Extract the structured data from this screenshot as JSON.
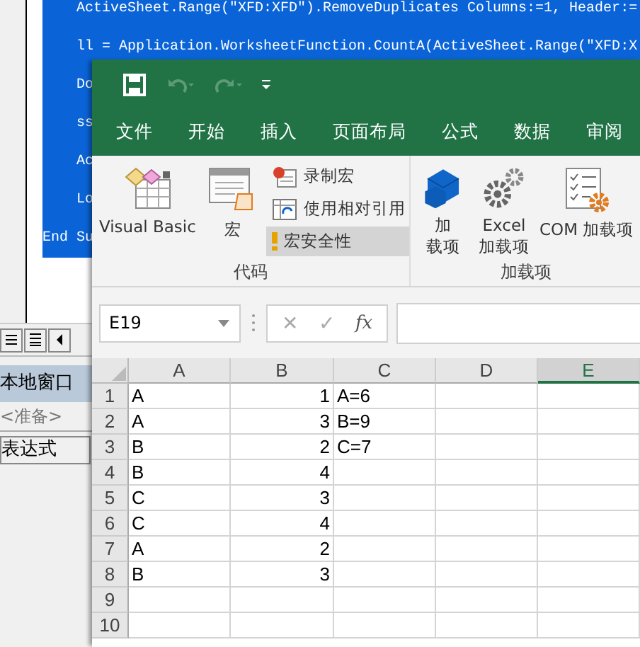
{
  "vba_editor": {
    "code_lines": [
      {
        "text": "ActiveSheet.Range(\"XFD:XFD\").RemoveDuplicates Columns:=1, Header:=",
        "indented": true,
        "selected": true
      },
      {
        "text": "ll = Application.WorksheetFunction.CountA(ActiveSheet.Range(\"XFD:X",
        "indented": true,
        "selected": true
      },
      {
        "text": "Do",
        "indented": true,
        "selected": true
      },
      {
        "text": "ss",
        "indented": true,
        "selected": true
      },
      {
        "text": "Ac",
        "indented": true,
        "selected": true
      },
      {
        "text": "Lo",
        "indented": true,
        "selected": true
      },
      {
        "text": "End Su",
        "indented": false,
        "selected": true
      }
    ],
    "locals_window": {
      "title": "本地窗口",
      "status": "<准备>",
      "column_header": "表达式"
    }
  },
  "excel": {
    "quick_access": [
      {
        "kind": "save",
        "disabled": false
      },
      {
        "kind": "undo",
        "disabled": true
      },
      {
        "kind": "redo",
        "disabled": true
      },
      {
        "kind": "customize",
        "disabled": false
      }
    ],
    "tabs": [
      {
        "label": "文件",
        "selected": false
      },
      {
        "label": "开始",
        "selected": false
      },
      {
        "label": "插入",
        "selected": false
      },
      {
        "label": "页面布局",
        "selected": false
      },
      {
        "label": "公式",
        "selected": false
      },
      {
        "label": "数据",
        "selected": false
      },
      {
        "label": "审阅",
        "selected": false
      }
    ],
    "ribbon_groups": [
      {
        "label": "代码",
        "items": [
          {
            "kind": "large",
            "label_lines": [
              "Visual Basic"
            ],
            "highlighted": false
          },
          {
            "kind": "large",
            "label_lines": [
              "宏"
            ],
            "highlighted": false
          },
          {
            "kind": "small",
            "label_lines": [
              "录制宏"
            ],
            "highlighted": false
          },
          {
            "kind": "small",
            "label_lines": [
              "使用相对引用"
            ],
            "highlighted": false
          },
          {
            "kind": "small",
            "label_lines": [
              "宏安全性"
            ],
            "highlighted": true
          }
        ]
      },
      {
        "label": "加载项",
        "items": [
          {
            "kind": "large",
            "label_lines": [
              "加",
              "载项"
            ],
            "highlighted": false
          },
          {
            "kind": "large",
            "label_lines": [
              "Excel",
              "加载项"
            ],
            "highlighted": false
          },
          {
            "kind": "large",
            "label_lines": [
              "COM 加载项"
            ],
            "highlighted": false
          }
        ]
      }
    ],
    "formula_bar": {
      "name_box": "E19",
      "cancel": "✕",
      "enter": "✓",
      "insert_function": "fx",
      "buttons_disabled": true
    },
    "columns": [
      {
        "label": "A",
        "selected": false
      },
      {
        "label": "B",
        "selected": false
      },
      {
        "label": "C",
        "selected": false
      },
      {
        "label": "D",
        "selected": false
      },
      {
        "label": "E",
        "selected": true
      }
    ],
    "rows": [
      {
        "number": "1",
        "cells": [
          {
            "text": "A",
            "kind": "text"
          },
          {
            "text": "1",
            "kind": "number"
          },
          {
            "text": "A=6",
            "kind": "text"
          }
        ]
      },
      {
        "number": "2",
        "cells": [
          {
            "text": "A",
            "kind": "text"
          },
          {
            "text": "3",
            "kind": "number"
          },
          {
            "text": "B=9",
            "kind": "text"
          }
        ]
      },
      {
        "number": "3",
        "cells": [
          {
            "text": "B",
            "kind": "text"
          },
          {
            "text": "2",
            "kind": "number"
          },
          {
            "text": "C=7",
            "kind": "text"
          }
        ]
      },
      {
        "number": "4",
        "cells": [
          {
            "text": "B",
            "kind": "text"
          },
          {
            "text": "4",
            "kind": "number"
          }
        ]
      },
      {
        "number": "5",
        "cells": [
          {
            "text": "C",
            "kind": "text"
          },
          {
            "text": "3",
            "kind": "number"
          }
        ]
      },
      {
        "number": "6",
        "cells": [
          {
            "text": "C",
            "kind": "text"
          },
          {
            "text": "4",
            "kind": "number"
          }
        ]
      },
      {
        "number": "7",
        "cells": [
          {
            "text": "A",
            "kind": "text"
          },
          {
            "text": "2",
            "kind": "number"
          }
        ]
      },
      {
        "number": "8",
        "cells": [
          {
            "text": "B",
            "kind": "text"
          },
          {
            "text": "3",
            "kind": "number"
          }
        ]
      },
      {
        "number": "9"
      },
      {
        "number": "10"
      }
    ]
  }
}
